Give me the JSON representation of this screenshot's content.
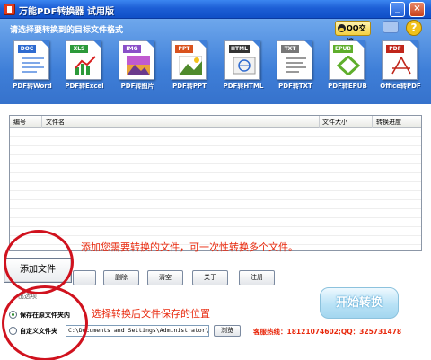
{
  "window": {
    "title": "万能PDF转换器 试用版",
    "min_glyph": "_",
    "close_glyph": "×"
  },
  "header": {
    "title": "请选择要转换到的目标文件格式",
    "qq_label": "QQ交谈",
    "help_glyph": "?"
  },
  "formats": [
    {
      "badge": "DOC",
      "label": "PDF转Word",
      "color": "#2f6bd0",
      "icon": "word-doc-icon"
    },
    {
      "badge": "XLS",
      "label": "PDF转Excel",
      "color": "#2c9a3a",
      "icon": "excel-chart-icon"
    },
    {
      "badge": "IMG",
      "label": "PDF转图片",
      "color": "#8a4fc8",
      "icon": "image-icon"
    },
    {
      "badge": "PPT",
      "label": "PDF转PPT",
      "color": "#d9531e",
      "icon": "ppt-icon"
    },
    {
      "badge": "HTML",
      "label": "PDF转HTML",
      "color": "#333333",
      "icon": "html-icon"
    },
    {
      "badge": "TXT",
      "label": "PDF转TXT",
      "color": "#777777",
      "icon": "txt-icon"
    },
    {
      "badge": "EPUB",
      "label": "PDF转EPUB",
      "color": "#5fae2c",
      "icon": "epub-icon"
    },
    {
      "badge": "PDF",
      "label": "Office转PDF",
      "color": "#c0261a",
      "icon": "pdf-icon"
    }
  ],
  "table": {
    "columns": [
      "编号",
      "文件名",
      "文件大小",
      "转换进度"
    ],
    "rows": []
  },
  "hints": {
    "add_files": "添加您需要转换的文件，可一次性转换多个文件。",
    "save_location": "选择转换后文件保存的位置"
  },
  "buttons": {
    "add_file": "添加文件",
    "delete": "删除",
    "clear": "清空",
    "about": "关于",
    "register": "注册",
    "start": "开始转换",
    "browse": "浏览"
  },
  "output": {
    "group_label": "出选项",
    "option_same_folder": "保存在原文件夹内",
    "option_custom_folder": "自定义文件夹",
    "selected": "option_same_folder",
    "path": "C:\\Documents and Settings\\Administrator\\桌面"
  },
  "hotline": "客服热线：18121074602;QQ：325731478",
  "colors": {
    "accent": "#3f7fd8",
    "hint": "#e8280c",
    "circle": "#d0121e"
  }
}
